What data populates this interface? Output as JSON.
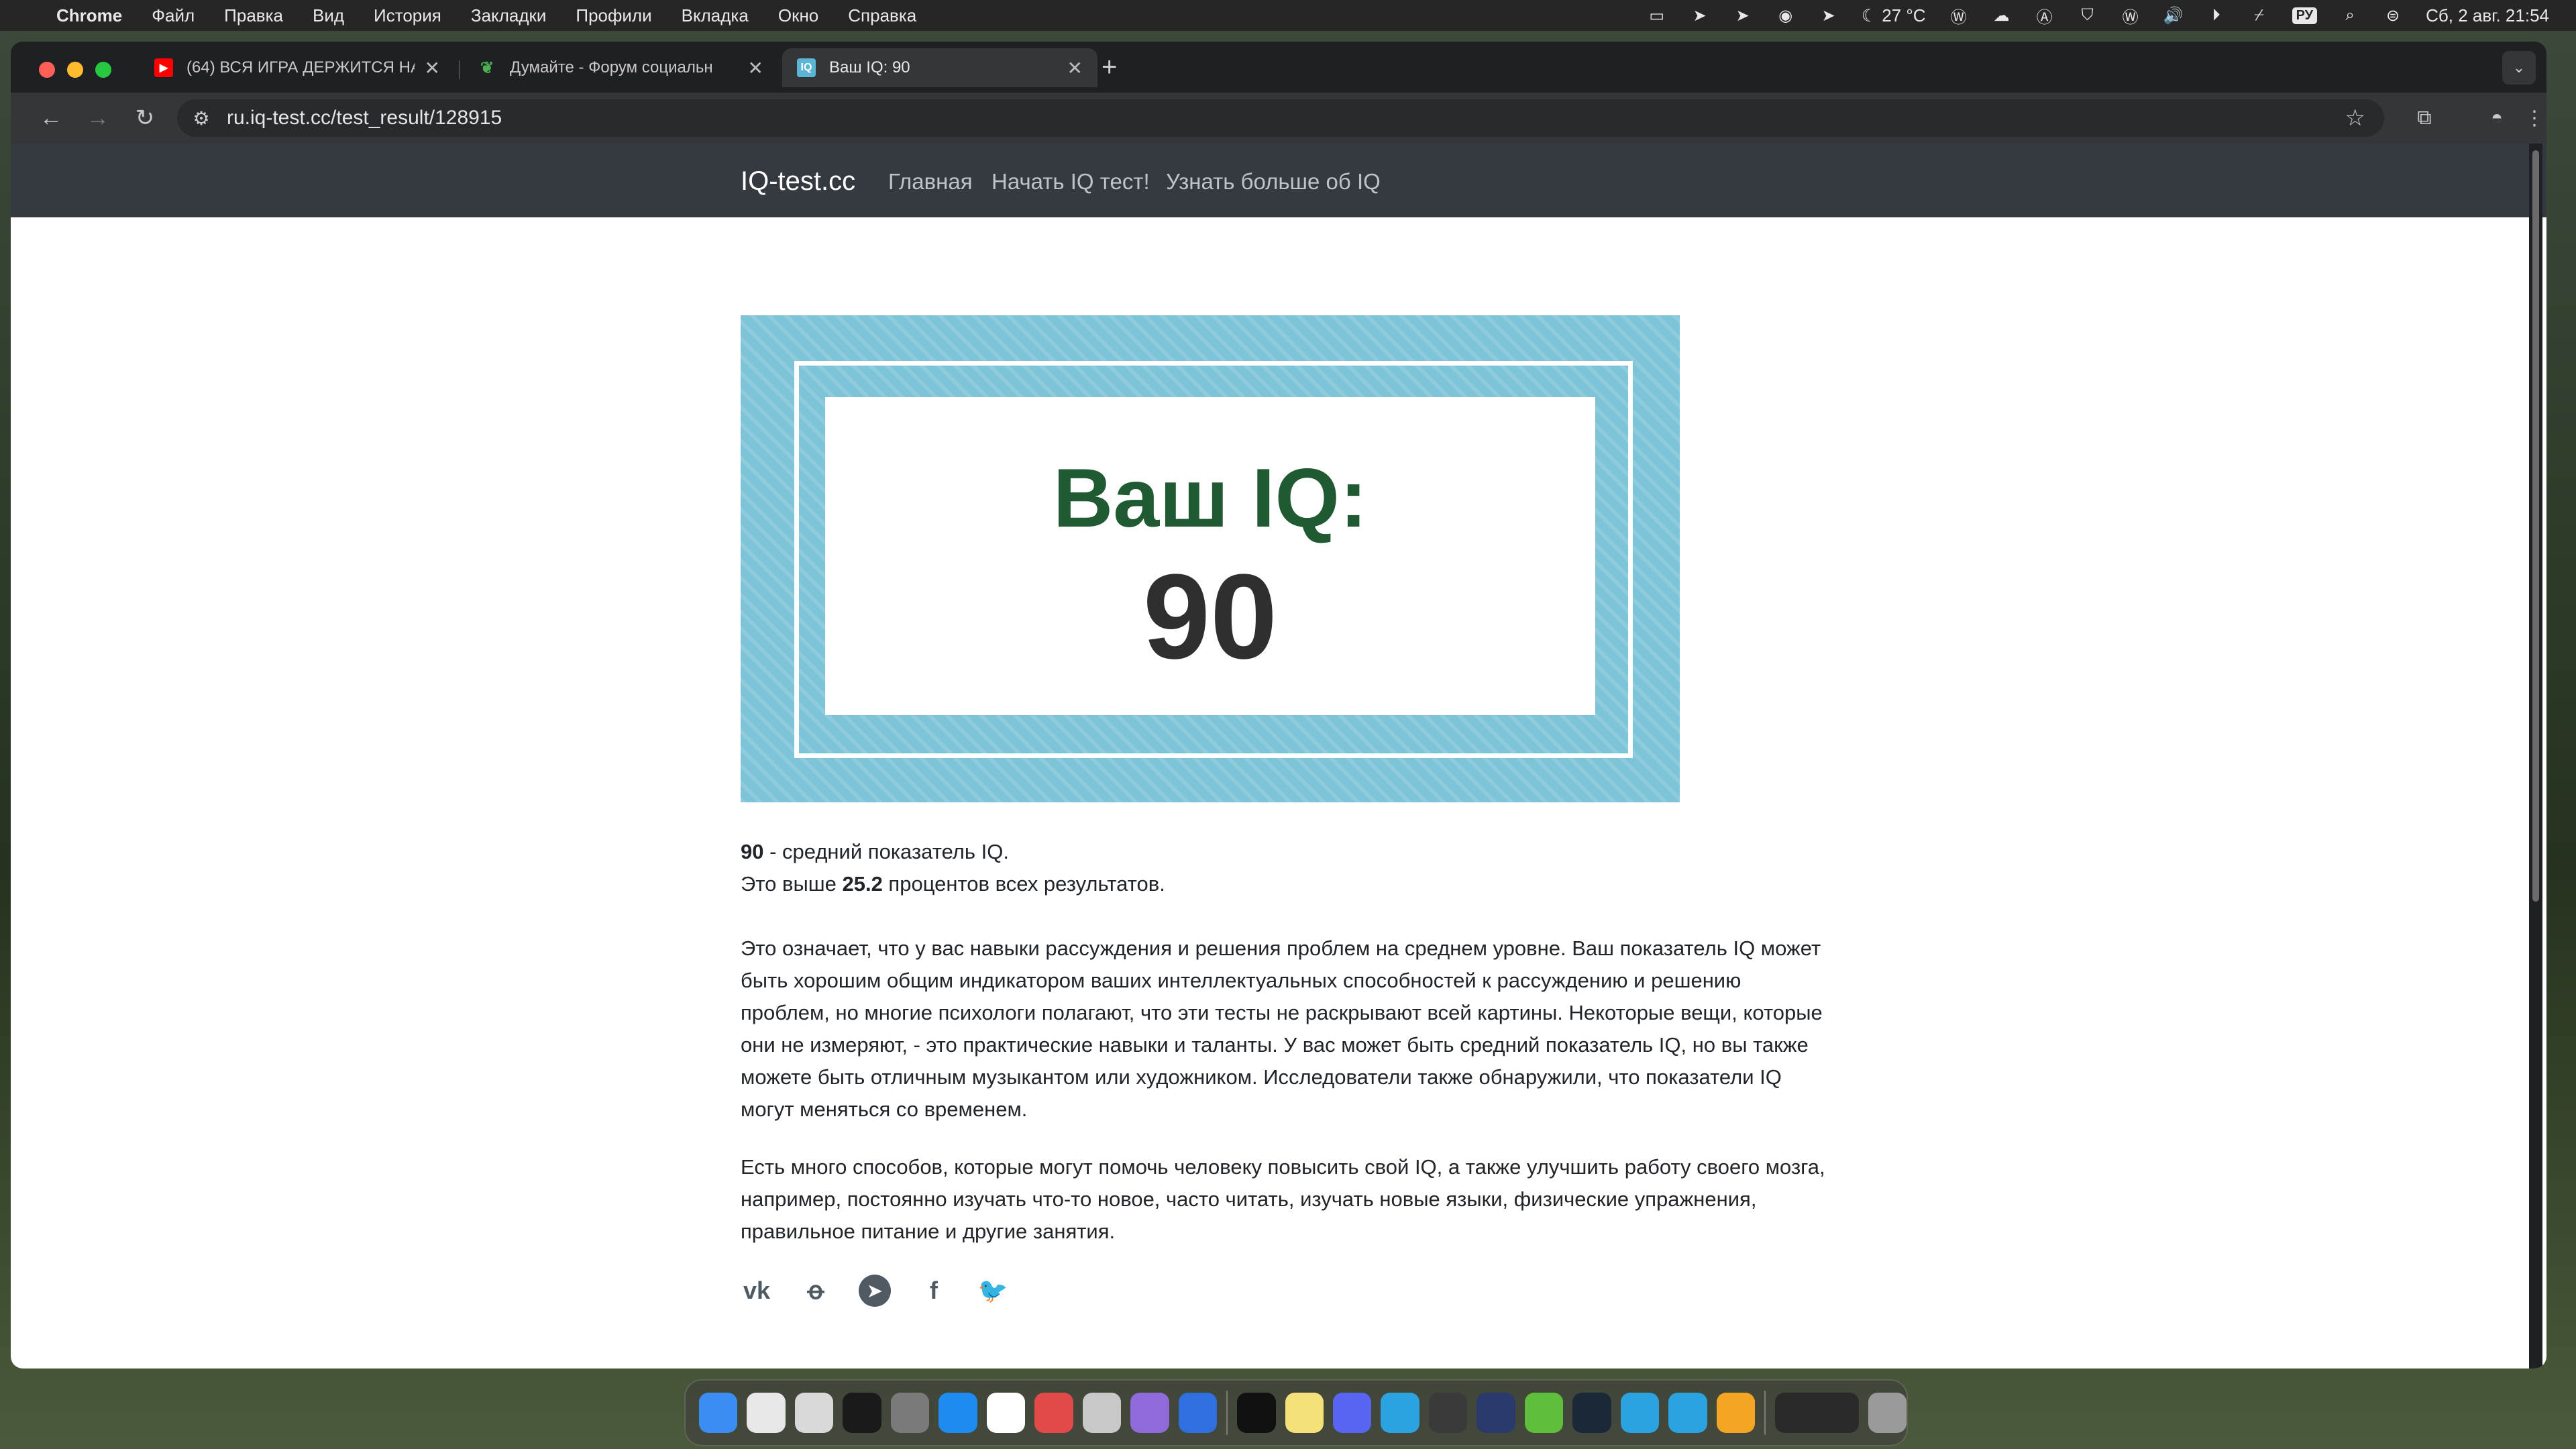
{
  "menubar": {
    "app": "Chrome",
    "menus": [
      "Файл",
      "Правка",
      "Вид",
      "История",
      "Закладки",
      "Профили",
      "Вкладка",
      "Окно",
      "Справка"
    ],
    "weather": "27 °C",
    "input_lang": "РУ",
    "datetime": "Сб, 2 авг.  21:54"
  },
  "tabs": [
    {
      "title": "(64) ВСЯ ИГРА ДЕРЖИТСЯ НА",
      "favicon": "youtube-icon"
    },
    {
      "title": "Думайте - Форум социальн",
      "favicon": "forum-icon"
    },
    {
      "title": "Ваш IQ: 90",
      "favicon": "iq-icon"
    }
  ],
  "address_bar": {
    "url": "ru.iq-test.cc/test_result/128915"
  },
  "site": {
    "brand": "IQ-test.cc",
    "nav": [
      "Главная",
      "Начать IQ тест!",
      "Узнать больше об IQ"
    ]
  },
  "result": {
    "banner_label": "Ваш IQ:",
    "banner_score": "90",
    "score": "90",
    "score_text": " - средний показатель IQ.",
    "above_prefix": "Это выше ",
    "above_percent": "25.2",
    "above_suffix": " процентов всех результатов.",
    "paragraph1": "Это означает, что у вас навыки рассуждения и решения проблем на среднем уровне. Ваш показатель IQ может быть хорошим общим индикатором ваших интеллектуальных способностей к рассуждению и решению проблем, но многие психологи полагают, что эти тесты не раскрывают всей картины. Некоторые вещи, которые они не измеряют, - это практические навыки и таланты. У вас может быть средний показатель IQ, но вы также можете быть отличным музыкантом или художником. Исследователи также обнаружили, что показатели IQ могут меняться со временем.",
    "paragraph2": "Есть много способов, которые могут помочь человеку повысить свой IQ, а также улучшить работу своего мозга, например, постоянно изучать что-то новое, часто читать, изучать новые языки, физические упражнения, правильное питание и другие занятия."
  },
  "social_icons": [
    "vk-icon",
    "odnoklassniki-icon",
    "telegram-icon",
    "facebook-icon",
    "twitter-icon"
  ],
  "colors": {
    "banner": "#7dc4d8",
    "banner_label": "#1f5a33",
    "site_nav": "#343a40"
  }
}
